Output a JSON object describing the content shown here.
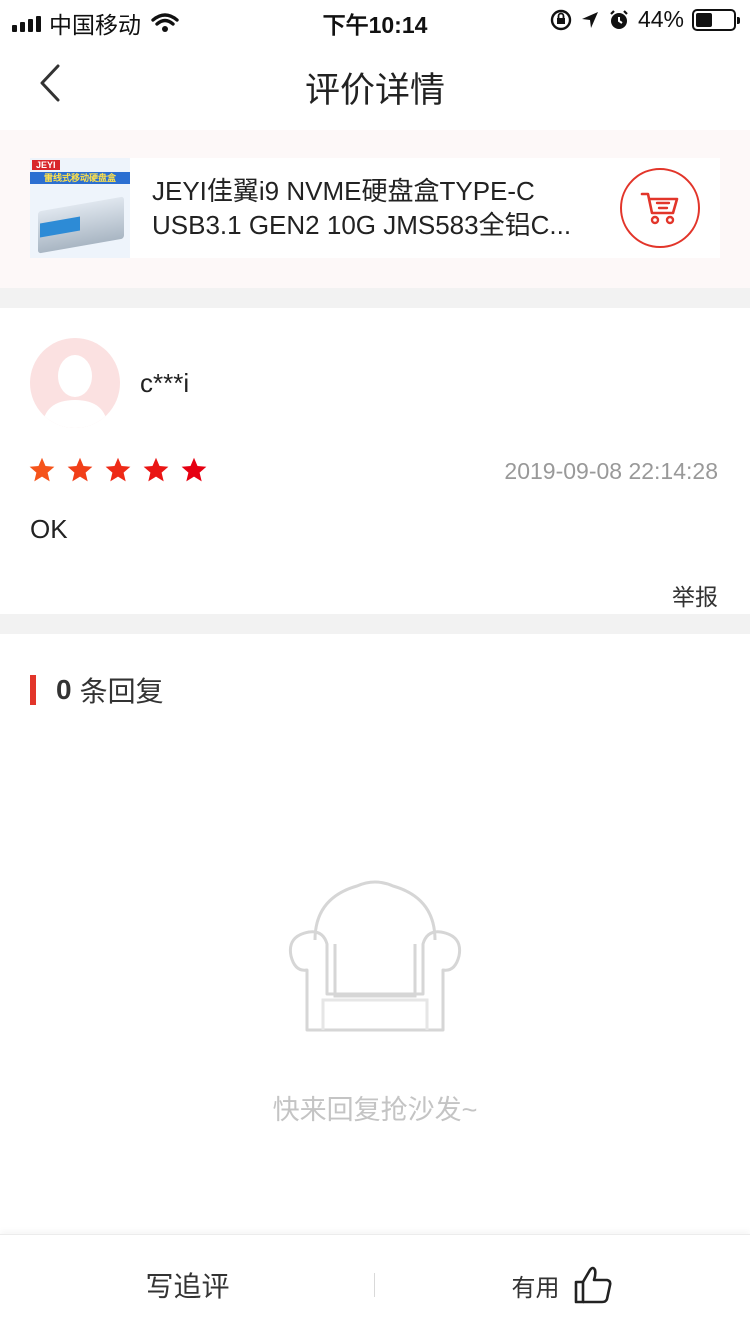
{
  "status_bar": {
    "carrier": "中国移动",
    "time": "下午10:14",
    "battery": "44%",
    "battery_level": 0.44
  },
  "nav": {
    "title": "评价详情"
  },
  "product": {
    "name": "JEYI佳翼i9 NVME硬盘盒TYPE-C USB3.1 GEN2 10G JMS583全铝C...",
    "thumb_brand": "JEYI",
    "thumb_tagline": "雷线式移动硬盘盒"
  },
  "review": {
    "username": "c***i",
    "rating": 5,
    "time": "2019-09-08 22:14:28",
    "content": "OK",
    "report_label": "举报"
  },
  "replies": {
    "count": "0",
    "label": "条回复",
    "empty_text": "快来回复抢沙发~"
  },
  "bottom_bar": {
    "write_label": "写追评",
    "useful_label": "有用"
  },
  "colors": {
    "accent": "#e2352a",
    "star_start": "#f5541b",
    "star_end": "#e60012"
  }
}
